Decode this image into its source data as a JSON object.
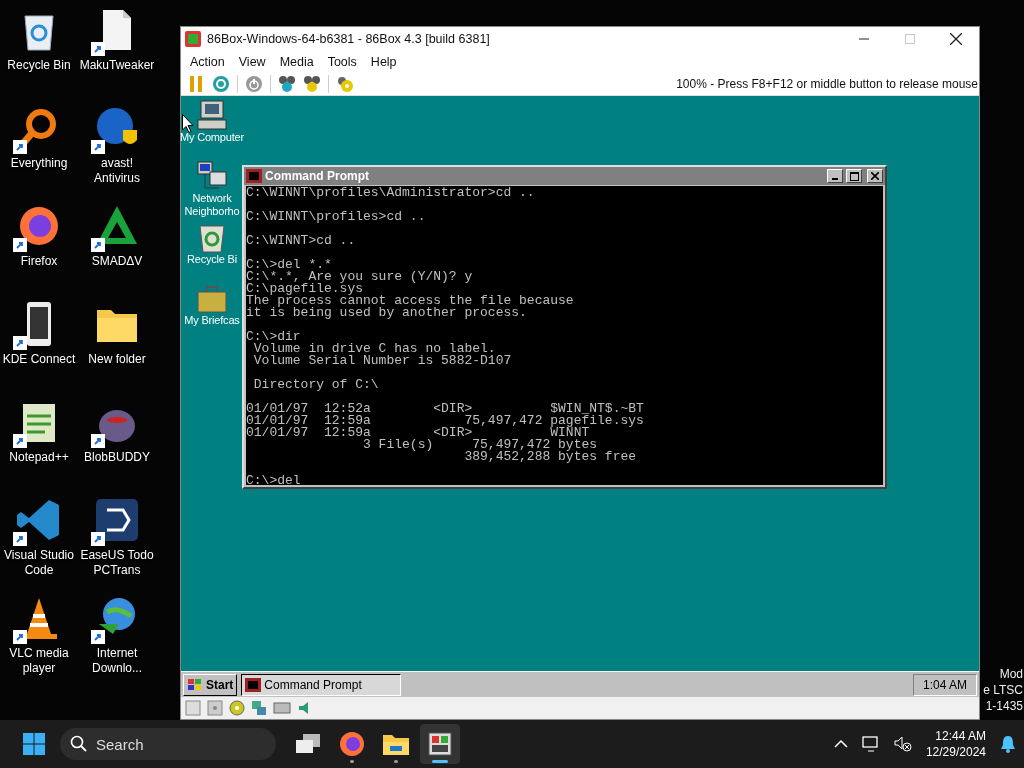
{
  "desktop_icons": [
    {
      "label": "Recycle Bin",
      "kind": "recycle",
      "shortcut": false
    },
    {
      "label": "MakuTweaker",
      "kind": "document",
      "shortcut": true
    },
    {
      "label": "Everything",
      "kind": "magnifier",
      "shortcut": true
    },
    {
      "label": "avast! Antivirus",
      "kind": "shield",
      "shortcut": true
    },
    {
      "label": "Firefox",
      "kind": "firefox",
      "shortcut": true
    },
    {
      "label": "SMADΔV",
      "kind": "triangle",
      "shortcut": true
    },
    {
      "label": "KDE Connect",
      "kind": "phone",
      "shortcut": true
    },
    {
      "label": "New folder",
      "kind": "folder",
      "shortcut": false
    },
    {
      "label": "Notepad++",
      "kind": "notepad",
      "shortcut": true
    },
    {
      "label": "BlobBUDDY",
      "kind": "blob",
      "shortcut": true
    },
    {
      "label": "Visual Studio Code",
      "kind": "code",
      "shortcut": true
    },
    {
      "label": "EaseUS Todo PCTrans",
      "kind": "transfer",
      "shortcut": true
    },
    {
      "label": "VLC media player",
      "kind": "cone",
      "shortcut": true
    },
    {
      "label": "Internet Downlo...",
      "kind": "globe",
      "shortcut": true
    }
  ],
  "emulator": {
    "title": "86Box-Windows-64-b6381 - 86Box 4.3 [build 6381]",
    "controls": [
      {
        "kind": "minimize",
        "disabled": false
      },
      {
        "kind": "maximize",
        "disabled": true
      },
      {
        "kind": "close",
        "disabled": false
      }
    ],
    "menu": [
      "Action",
      "View",
      "Media",
      "Tools",
      "Help"
    ],
    "toolbar": [
      {
        "kind": "pause"
      },
      {
        "kind": "reset"
      },
      {
        "kind": "power"
      },
      {
        "kind": "cad"
      },
      {
        "kind": "cae"
      },
      {
        "kind": "settings"
      }
    ],
    "status_text": "100% - Press F8+F12 or middle button to release mouse",
    "guest": {
      "desktop_icons": [
        {
          "label": "My Computer",
          "kind": "computer"
        },
        {
          "label": "Network Neighborho",
          "kind": "network"
        },
        {
          "label": "Recycle Bi",
          "kind": "recycle"
        },
        {
          "label": "My Briefcas",
          "kind": "briefcase"
        }
      ],
      "console": {
        "title": "Command Prompt",
        "blocks": [
          [
            "C:\\WINNT\\profiles\\Administrator>cd .."
          ],
          [
            "C:\\WINNT\\profiles>cd .."
          ],
          [
            "C:\\WINNT>cd .."
          ],
          [
            "C:\\>del *.*",
            "C:\\*.*, Are you sure (Y/N)? y",
            "C:\\pagefile.sys",
            "The process cannot access the file because",
            "it is being used by another process."
          ],
          [
            "C:\\>dir",
            " Volume in drive C has no label.",
            " Volume Serial Number is 5882-D107"
          ],
          [
            " Directory of C:\\"
          ],
          [
            "01/01/97  12:52a        <DIR>          $WIN_NT$.~BT",
            "01/01/97  12:59a            75,497,472 pagefile.sys",
            "01/01/97  12:59a        <DIR>          WINNT",
            "               3 File(s)     75,497,472 bytes",
            "                            389,452,288 bytes free"
          ],
          [
            "C:\\>del"
          ]
        ]
      },
      "taskbar": {
        "start": "Start",
        "tasks": [
          {
            "label": "Command Prompt",
            "selected": true
          }
        ],
        "clock": "1:04 AM"
      }
    }
  },
  "edge_text": [
    "Mod",
    "e LTSC",
    "1-1435"
  ],
  "taskbar": {
    "search_placeholder": "Search",
    "apps": [
      {
        "kind": "taskview",
        "selected": false
      },
      {
        "kind": "firefox",
        "selected": false
      },
      {
        "kind": "explorer",
        "selected": false
      },
      {
        "kind": "emulator",
        "selected": true
      }
    ],
    "time": "12:44 AM",
    "date": "12/29/2024"
  }
}
